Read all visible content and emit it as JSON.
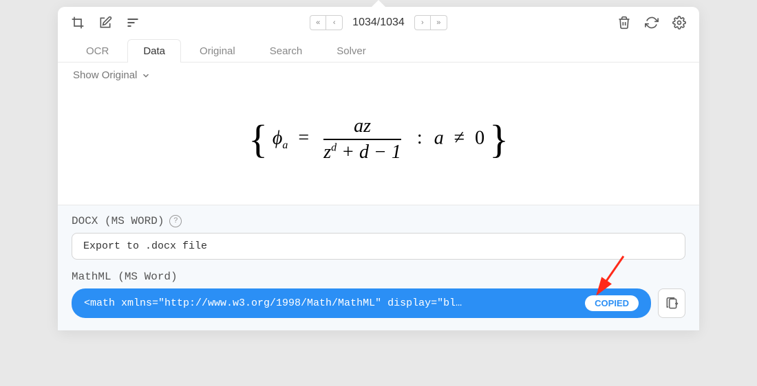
{
  "pager": {
    "counter": "1034/1034"
  },
  "tabs": {
    "items": [
      "OCR",
      "Data",
      "Original",
      "Search",
      "Solver"
    ],
    "active": "Data"
  },
  "subToggle": {
    "label": "Show Original"
  },
  "formula": {
    "phi": "ϕ",
    "sub_a": "a",
    "eq": "=",
    "num": "az",
    "den_z": "z",
    "den_d": "d",
    "den_rest": " + d − 1",
    "colon": ":",
    "cond_a": "a",
    "neq": "≠",
    "zero": "0"
  },
  "export": {
    "docx_label": "DOCX (MS WORD)",
    "docx_action": "Export to .docx file",
    "mathml_label": "MathML (MS Word)",
    "mathml_content": "<math xmlns=\"http://www.w3.org/1998/Math/MathML\" display=\"bl…",
    "copied_label": "COPIED"
  }
}
